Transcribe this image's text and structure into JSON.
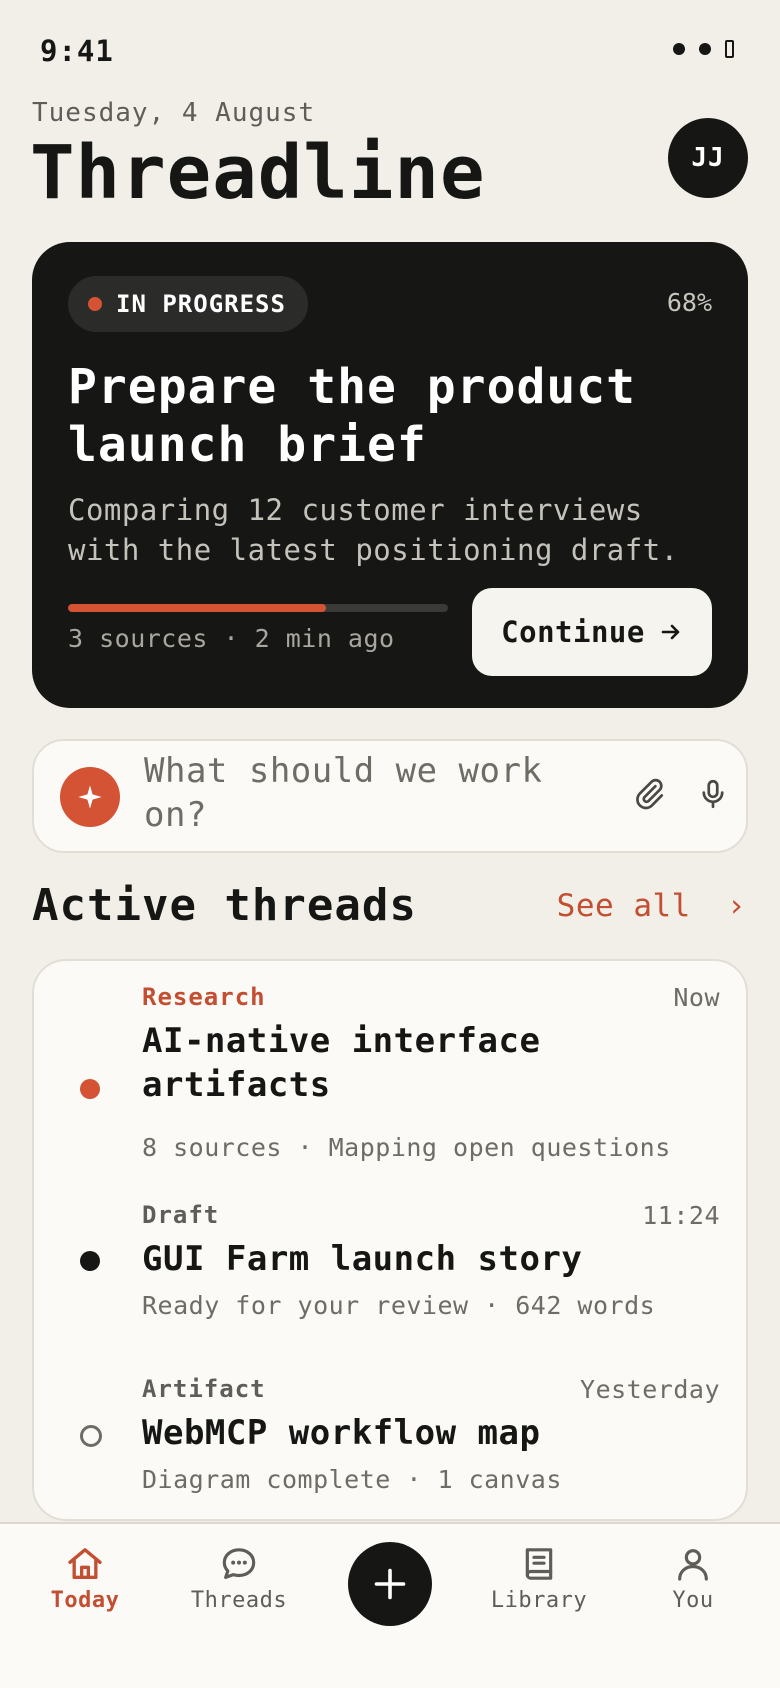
{
  "status_bar": {
    "time": "9:41"
  },
  "header": {
    "date": "Tuesday, 4 August",
    "title": "Threadline",
    "avatar_initials": "JJ"
  },
  "hero": {
    "status": "IN PROGRESS",
    "percent_label": "68%",
    "progress": 0.68,
    "title": "Prepare the product launch brief",
    "description": "Comparing 12 customer interviews with the latest positioning draft.",
    "meta": "3 sources · 2 min ago",
    "continue_label": "Continue",
    "accent": "#d35334"
  },
  "prompt": {
    "placeholder": "What should we work on?"
  },
  "threads_section": {
    "title": "Active threads",
    "see_all": "See all",
    "chevron": "›"
  },
  "threads": [
    {
      "category": "Research",
      "time": "Now",
      "title": "AI-native interface artifacts",
      "meta": "8 sources · Mapping open questions",
      "status": "active"
    },
    {
      "category": "Draft",
      "time": "11:24",
      "title": "GUI Farm launch story",
      "meta": "Ready for your review · 642 words",
      "status": "review"
    },
    {
      "category": "Artifact",
      "time": "Yesterday",
      "title": "WebMCP workflow map",
      "meta": "Diagram complete · 1 canvas",
      "status": "done"
    }
  ],
  "nav": {
    "today": "Today",
    "threads": "Threads",
    "library": "Library",
    "you": "You"
  },
  "colors": {
    "accent": "#d35334",
    "accent_text": "#c24f32",
    "dark": "#161715",
    "background": "#f2efe9"
  }
}
